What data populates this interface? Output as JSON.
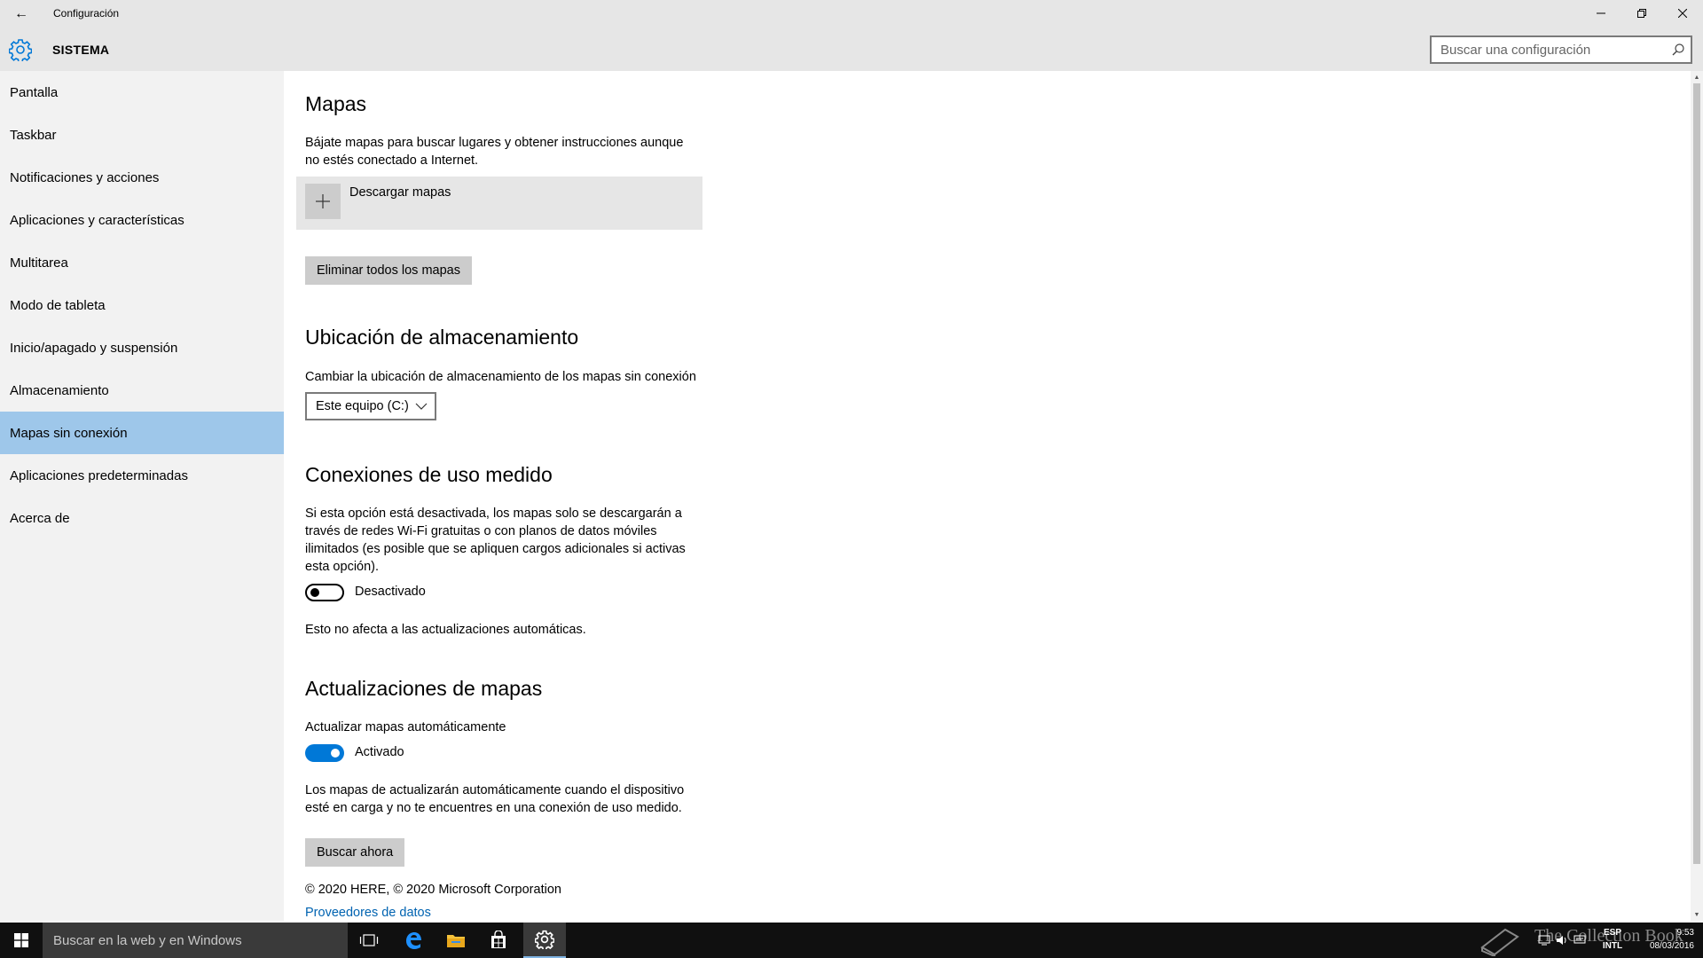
{
  "window": {
    "title": "Configuración",
    "back_icon": "←",
    "minimize_icon": "—",
    "maximize_icon": "❐",
    "close_icon": "✕"
  },
  "header": {
    "section": "SISTEMA",
    "search_placeholder": "Buscar una configuración"
  },
  "sidebar": {
    "items": [
      {
        "label": "Pantalla"
      },
      {
        "label": "Taskbar"
      },
      {
        "label": "Notificaciones y acciones"
      },
      {
        "label": "Aplicaciones y características"
      },
      {
        "label": "Multitarea"
      },
      {
        "label": "Modo de tableta"
      },
      {
        "label": "Inicio/apagado y suspensión"
      },
      {
        "label": "Almacenamiento"
      },
      {
        "label": "Mapas sin conexión"
      },
      {
        "label": "Aplicaciones predeterminadas"
      },
      {
        "label": "Acerca de"
      }
    ],
    "active_index": 8
  },
  "maps": {
    "title": "Mapas",
    "description_line1": "Bájate mapas para buscar lugares y obtener instrucciones aunque",
    "description_line2": "no estés conectado a Internet.",
    "download_label": "Descargar mapas",
    "delete_all_button": "Eliminar todos los mapas"
  },
  "storage": {
    "title": "Ubicación de almacenamiento",
    "description": "Cambiar la ubicación de almacenamiento de los mapas sin conexión",
    "selected": "Este equipo (C:)"
  },
  "metered": {
    "title": "Conexiones de uso medido",
    "description_line1": "Si esta opción está desactivada, los mapas solo se descargarán a",
    "description_line2": "través de redes Wi-Fi gratuitas o con planos de datos móviles",
    "description_line3": "ilimitados (es posible que se apliquen cargos adicionales si activas",
    "description_line4": "esta opción).",
    "toggle_state": "off",
    "toggle_label": "Desactivado",
    "note": "Esto no afecta a las actualizaciones automáticas."
  },
  "updates": {
    "title": "Actualizaciones de mapas",
    "auto_label": "Actualizar mapas automáticamente",
    "toggle_state": "on",
    "toggle_label": "Activado",
    "description_line1": "Los mapas de actualizarán automáticamente cuando el dispositivo",
    "description_line2": "esté en carga y no te encuentres en una conexión de uso medido.",
    "check_button": "Buscar ahora"
  },
  "footer": {
    "copyright": "© 2020 HERE, © 2020 Microsoft Corporation",
    "data_providers_link": "Proveedores de datos"
  },
  "taskbar": {
    "search_placeholder": "Buscar en la web y en Windows",
    "watermark": "The Collection Book",
    "lang_line1": "ESP",
    "lang_line2": "INTL",
    "time": "9:53",
    "date": "08/03/2016"
  },
  "colors": {
    "accent": "#0078d7",
    "sidebar_active": "#9ec7ea",
    "link": "#0063b1",
    "taskbar": "#101010"
  }
}
